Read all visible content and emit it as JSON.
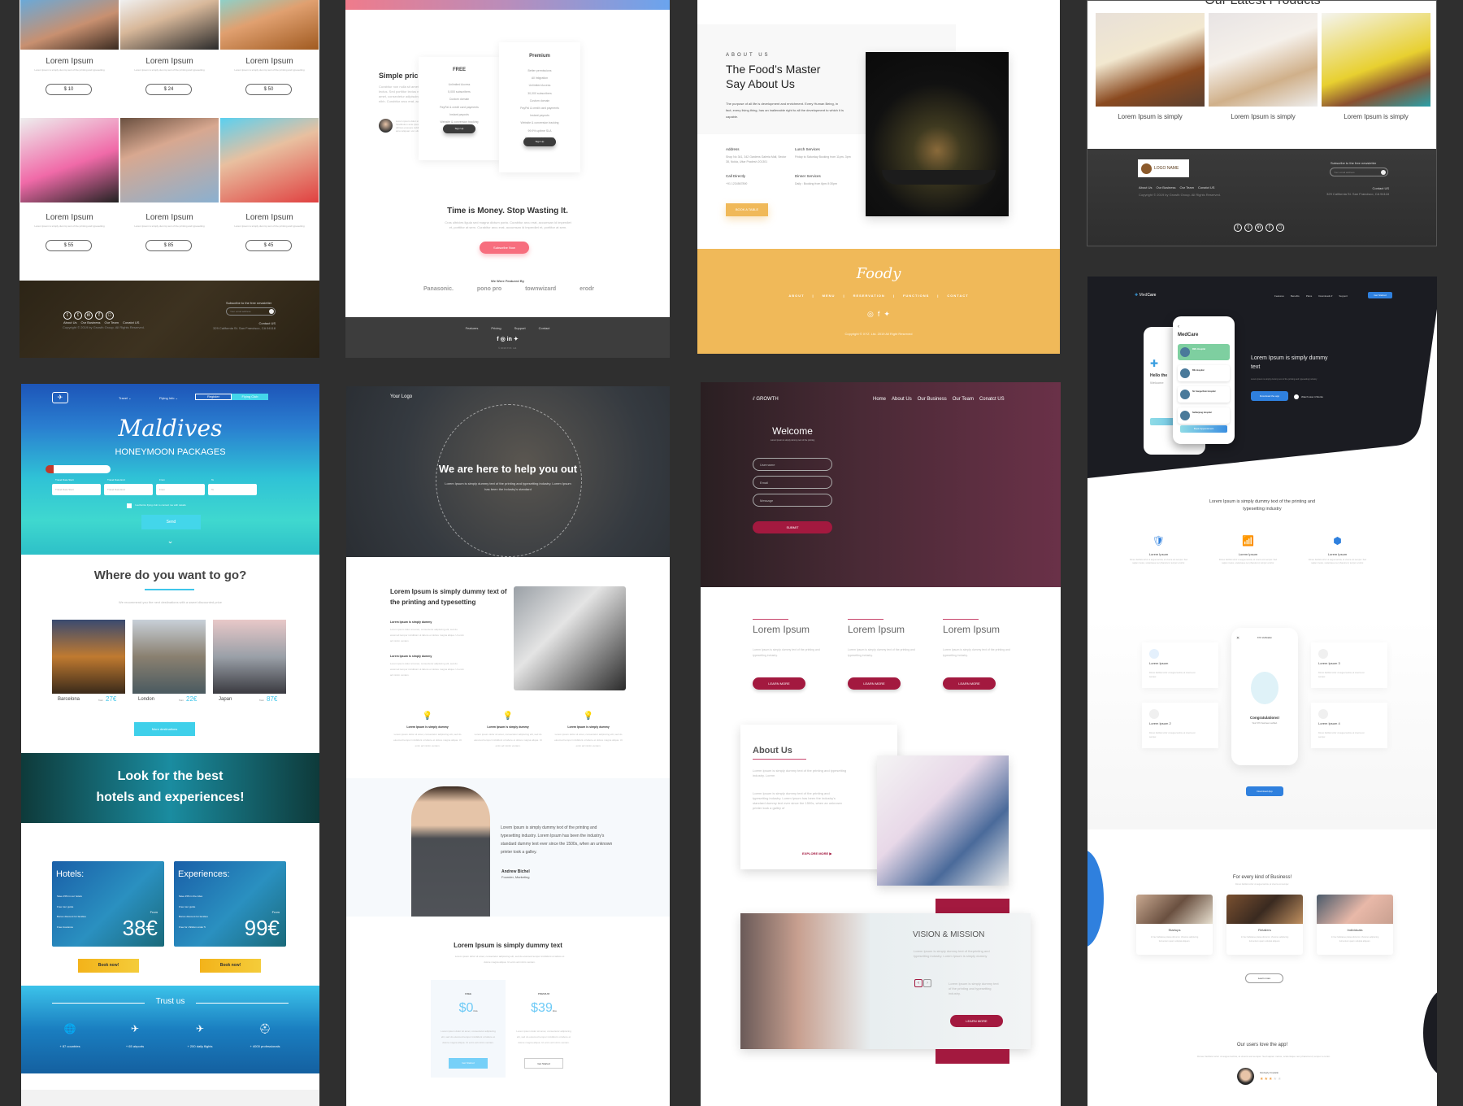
{
  "fashion": {
    "products": [
      {
        "title": "Lorem Ipsum",
        "desc": "Lorem Ipsum is simply dummy text of the printing and typesetting",
        "price": "$ 10"
      },
      {
        "title": "Lorem Ipsum",
        "desc": "Lorem Ipsum is simply dummy text of the printing and typesetting",
        "price": "$ 24"
      },
      {
        "title": "Lorem Ipsum",
        "desc": "Lorem Ipsum is simply dummy text of the printing and typesetting",
        "price": "$ 50"
      },
      {
        "title": "Lorem Ipsum",
        "desc": "Lorem Ipsum is simply dummy text of the printing and typesetting",
        "price": "$ 55"
      },
      {
        "title": "Lorem Ipsum",
        "desc": "Lorem Ipsum is simply dummy text of the printing and typesetting",
        "price": "$ 85"
      },
      {
        "title": "Lorem Ipsum",
        "desc": "Lorem Ipsum is simply dummy text of the printing and typesetting",
        "price": "$ 45"
      }
    ],
    "footer": {
      "links": [
        "About Us",
        "Our Business",
        "Our Team",
        "Conatct US"
      ],
      "copyright": "Copyright © 2019 by Growth Group. All Rights Reserved.",
      "newsletter_label": "Subscribe to the free newsletter",
      "email_placeholder": "Your email address",
      "contact_title": "Contact US",
      "address": "329 California St. San Francisco, CA 94118"
    }
  },
  "pricing": {
    "title": "Simple pricing.",
    "intro": "Curabitur non nulla sit amet nisl tempus convallis quis ac lectus. Sed porttitor lectus nibh. Lorem ipsum dolor sit amet, consectetur adipiscing elit. Sed porttitor lectus nibh. Curabitur arcu erat, accumsan.",
    "testimonial": "Lorem ipsum dolor sit amet, consectetur adipiscing elit. Vestibulum ante ipsum primis in faucibus orci luctus et ultrices posuere cubilia Curae; Donec velit neque, auctor sit amet aliquam vel, ullamcorper sit amet ligula.",
    "plans": [
      {
        "name": "FREE",
        "features": [
          "Unlimited Access",
          "5,000 subscribers",
          "Custom domain",
          "PayPal & credit card payments",
          "Instant payouts",
          "Website & conversion tracking"
        ],
        "button": "Sign Up"
      },
      {
        "name": "Premium",
        "features": [
          "Better permissions",
          "All Intigration",
          "Unlimited Access",
          "30,000 subscribers",
          "Custom domain",
          "PayPal & credit card payments",
          "Instant payouts",
          "Website & conversion tracking",
          "99.9% uptime SLA",
          "Basic support via email"
        ],
        "button": "Sign Up"
      }
    ],
    "cta_title": "Time is Money. Stop Wasting It.",
    "cta_text": "Cras ultricies ligula sed magna dictum porta. Curabitur arcu erat, accumsan id imperdiet et, porttitor at sem. Curabitur arcu erat, accumsan id imperdiet et, porttitor at sem.",
    "cta_button": "Subscribe Now",
    "featured_label": "We Were Featured By",
    "brands": [
      "Panasonic.",
      "pono pro",
      "townwizard",
      "erodr"
    ],
    "footer_links": [
      "Features",
      "Pricing",
      "Support",
      "Contact"
    ],
    "copyright": "© 2019 XYZ. Ltd."
  },
  "foody": {
    "eyebrow": "ABOUT US",
    "title_line1": "The Food’s Master",
    "title_line2": "Say About Us",
    "text": "The purpose of all life is development and enrichment. Every Human Being, in fact, every living thing, has an inalienable right to all the development to which it is capable.",
    "info": [
      {
        "label": "Address",
        "value": "Shop No 341, 342 Gardens Galeria Mall, Sector 38, Noida, Uttar Pradesh 201301"
      },
      {
        "label": "Lunch Services",
        "value": "Friday to Saturday Booking from 11pm- 3pm"
      },
      {
        "label": "Call Directly",
        "value": "+91 1234567890"
      },
      {
        "label": "Dinner Services",
        "value": "Daily : Booking from 6pm-9:30pm"
      }
    ],
    "button": "BOOK A TABLE",
    "logo": "Foody",
    "nav": [
      "ABOUT",
      "MENU",
      "RESERVATION",
      "FUNCTIONS",
      "CONTACT"
    ],
    "copyright": "Copyright © XYZ. Ltd. 2019 All Right Reserved",
    "accent": "#f0b959"
  },
  "furniture": {
    "heading": "Our Latest Products",
    "products": [
      "Lorem Ipsum is simply",
      "Lorem Ipsum is simply",
      "Lorem Ipsum is simply"
    ],
    "logo": "LOGO NAME",
    "links": [
      "About Us",
      "Our Business",
      "Our Team",
      "Conatct US"
    ],
    "copyright": "Copyright © 2019 by Growth Group. All Rights Reserved.",
    "newsletter_label": "Subscribe to the free newsletter",
    "email_placeholder": "Your email address",
    "contact_title": "Contact US",
    "address": "329 California St. San Francisco, CA 94118"
  },
  "travel": {
    "nav": [
      "Travel",
      "Flying Info",
      "Register",
      "Flying Club"
    ],
    "script_title": "Maldives",
    "subtitle": "HONEYMOON PACKAGES",
    "fields": [
      {
        "label": "Travel Date Start",
        "placeholder": "Travel Date Start"
      },
      {
        "label": "Travel Date End",
        "placeholder": "Travel Date End"
      },
      {
        "label": "From",
        "placeholder": "From"
      },
      {
        "label": "To",
        "placeholder": "To"
      }
    ],
    "consent": "I authorize flying club to contact me with details",
    "send": "Send",
    "where_title": "Where do you want to go?",
    "where_text": "We recommend you the next destinations with a sweet discounted price",
    "destinations": [
      {
        "name": "Barcelona",
        "from": "from",
        "price": "27€"
      },
      {
        "name": "London",
        "from": "from",
        "price": "22€"
      },
      {
        "name": "Japan",
        "from": "from",
        "price": "87€"
      }
    ],
    "more_button": "More destinations",
    "banner_line1": "Look for the best",
    "banner_line2": "hotels and experiences!",
    "offers": [
      {
        "title": "Hotels:",
        "items": [
          "Save 15% in our hotels",
          "Free tour guide",
          "Bonus discount for families",
          "Free insurance"
        ],
        "from": "From",
        "price": "38€",
        "button": "Book now!"
      },
      {
        "title": "Experiences:",
        "items": [
          "Save 15% in the rides",
          "Free tour guide",
          "Bonus discount for families",
          "Free for children under 5"
        ],
        "from": "From",
        "price": "99€",
        "button": "Book now!"
      }
    ],
    "trust_title": "Trust us",
    "stats": [
      "+ 87 countries",
      "+ 65 airports",
      "+ 200 daily flights",
      "+ 4000 professionals"
    ]
  },
  "agency": {
    "logo": "Your Logo",
    "hero_title": "We are here to help you out",
    "hero_text": "Lorem Ipsum is simply dummy text of the printing and typesetting industry. Lorem Ipsum has been the industry's standard",
    "intro_title": "Lorem Ipsum is simply dummy text of the printing and typesetting",
    "blocks": [
      {
        "title": "Lorem Ipsum is simply dummy",
        "text": "Lorem ipsum dolor sit amet, consectetur adipiscing elit, sed do eiusmod tempor incididunt ut labore et dolore magna aliqua. Ut enim ad minim veniam."
      },
      {
        "title": "Lorem Ipsum is simply dummy",
        "text": "Lorem ipsum dolor sit amet, consectetur adipiscing elit, sed do eiusmod tempor incididunt ut labore et dolore magna aliqua. Ut enim ad minim veniam."
      }
    ],
    "features": [
      {
        "title": "Lorem Ipsum is simply dummy",
        "text": "Lorem ipsum dolor sit amet, consectetur adipiscing elit, sed do eiusmod tempor incididunt ut labore et dolore magna aliqua. Ut enim ad minim veniam."
      },
      {
        "title": "Lorem Ipsum is simply dummy",
        "text": "Lorem ipsum dolor sit amet, consectetur adipiscing elit, sed do eiusmod tempor incididunt ut labore et dolore magna aliqua. Ut enim ad minim veniam."
      },
      {
        "title": "Lorem Ipsum is simply dummy",
        "text": "Lorem ipsum dolor sit amet, consectetur adipiscing elit, sed do eiusmod tempor incididunt ut labore et dolore magna aliqua. Ut enim ad minim veniam."
      }
    ],
    "quote": "Lorem Ipsum is simply dummy text of the printing and typesetting industry. Lorem Ipsum has been the industry's standard dummy text ever since the 1500s, when an unknown printer took a galley.",
    "author": "Andrew Bichel",
    "role": "Founder, Marketing",
    "pricing_title": "Lorem Ipsum is simply dummy text",
    "pricing_text": "Lorem ipsum dolor sit amet, consectetur adipiscing elit, sed do eiusmod tempor incididunt ut labore et dolore magna aliqua. Ut enim ad minim veniam.",
    "plans": [
      {
        "name": "FREE",
        "price": "$0",
        "per": "/mo",
        "text": "Lorem ipsum dolor sit amet, consectetur adipiscing elit, sed do eiusmod tempor incididunt ut labore et dolore magna aliqua. Ut enim ad minim veniam.",
        "button": "Get Started"
      },
      {
        "name": "PREMIUM",
        "price": "$39",
        "per": "/mo",
        "text": "Lorem ipsum dolor sit amet, consectetur adipiscing elit, sed do eiusmod tempor incididunt ut labore et dolore magna aliqua. Ut enim ad minim veniam.",
        "button": "Get Started"
      }
    ]
  },
  "growth": {
    "logo": "GROWTH",
    "nav": [
      "Home",
      "About Us",
      "Our Business",
      "Our Team",
      "Conatct US"
    ],
    "welcome": "Welcome",
    "welcome_sub": "Lorem Ipsum is simply dummy text of the printing",
    "fields": [
      "Username",
      "Email",
      "Message"
    ],
    "submit": "SUBMIT",
    "columns": [
      {
        "title": "Lorem Ipsum",
        "text": "Lorem Ipsum is simply dummy text of the printing and typesetting industry.",
        "button": "LEARN MORE"
      },
      {
        "title": "Lorem Ipsum",
        "text": "Lorem Ipsum is simply dummy text of the printing and typesetting industry.",
        "button": "LEARN MORE"
      },
      {
        "title": "Lorem Ipsum",
        "text": "Lorem Ipsum is simply dummy text of the printing and typesetting industry.",
        "button": "LEARN MORE"
      }
    ],
    "about_title": "About Us",
    "about_text1": "Lorem Ipsum is simply dummy text of the printing and typesetting industry. Lorem",
    "about_text2": "Lorem Ipsum is simply dummy text of the printing and typesetting industry. Lorem Ipsum has been the industry's standard dummy text ever since the 1500s, when an unknown printer took a galley of",
    "explore": "EXPLORE MORE ▶",
    "vision_title": "VISION & MISSION",
    "vision_text": "Lorem Ipsum is simply dummy text of theprinting and typesetting industry. Lorem Ipsum is simply dummy",
    "vision_text2": "Lorem Ipsum is simply dummy text of the printing and typesetting industry.",
    "vision_button": "LEARN MORE",
    "accent": "#a3193f"
  },
  "medcare": {
    "logo_a": "Med",
    "logo_b": "Care",
    "nav": [
      "Features",
      "Benefits",
      "Plans",
      "Downloads ▾",
      "Support"
    ],
    "nav_button": "Get Started",
    "app_title": "MedCare",
    "hospitals": [
      "RML Hospital",
      "Blk Hospital",
      "Sir Ganga Ram Hospital",
      "Safdarjung Hospital"
    ],
    "book_button": "Book Appointment",
    "back_phone_title": "Hello the",
    "back_phone_sub": "Welcome",
    "hero_title": "Lorem Ipsum is simply dummy text",
    "hero_text": "Lorem Ipsum is simply dummy text of the printing and typesetting industry",
    "download": "Download the app",
    "watch": "Watch How it Works",
    "section_title": "Lorem Ipsum is simply dummy text of the printing and typesetting industry",
    "features": [
      {
        "title": "Lorem Ipsum",
        "text": "Donec facilisis tortor ut augue lacinia, at viverra est semper. Sed sapien metus, scelerisque nec pharetra id, tempor a tortor."
      },
      {
        "title": "Lorem Ipsum",
        "text": "Donec facilisis tortor ut augue lacinia, at viverra est semper. Sed sapien metus, scelerisque nec pharetra id, tempor a tortor."
      },
      {
        "title": "Lorem Ipsum",
        "text": "Donec facilisis tortor ut augue lacinia, at viverra est semper. Sed sapien metus, scelerisque nec pharetra id, tempor a tortor."
      }
    ],
    "cards": [
      {
        "title": "Lorem Ipsum",
        "text": "Donec facilisis tortor ut augue lacinia, at viverra est semper."
      },
      {
        "title": "Lorem Ipsum 2",
        "text": "Donec facilisis tortor ut augue lacinia, at viverra est semper."
      },
      {
        "title": "Lorem Ipsum 3",
        "text": "Donec facilisis tortor ut augue lacinia, at viverra est semper."
      },
      {
        "title": "Lorem Ipsum 4",
        "text": "Donec facilisis tortor ut augue lacinia, at viverra est semper."
      }
    ],
    "kyc_title": "KYC Verification",
    "kyc_congrats": "Congratulations!",
    "kyc_text": "Your KYC has been verified.",
    "download_app": "Download App",
    "biz_title": "For every kind of Business!",
    "biz_text": "Donec facilisis tortor ut augue lacinia, at viverra est semper.",
    "biz": [
      {
        "title": "Startups",
        "text": "In hac habitasse platea dictumst. Vivamus adipiscing fermentum quam volutpat aliquam."
      },
      {
        "title": "Retailers",
        "text": "In hac habitasse platea dictumst. Vivamus adipiscing fermentum quam volutpat aliquam."
      },
      {
        "title": "Individuals",
        "text": "In hac habitasse platea dictumst. Vivamus adipiscing fermentum quam volutpat aliquam."
      }
    ],
    "learn_more": "Learn more",
    "love_title": "Our users love the app!",
    "love_text": "Donec facilisis tortor ut augue lacinia, at viverra est semper. Sed sapien metus, scelerisque nec pharetra id, tempor a tortor.",
    "reviewer": "Kimberly Franklin",
    "rating": 3,
    "rating_max": 5,
    "accent": "#2f80de"
  }
}
